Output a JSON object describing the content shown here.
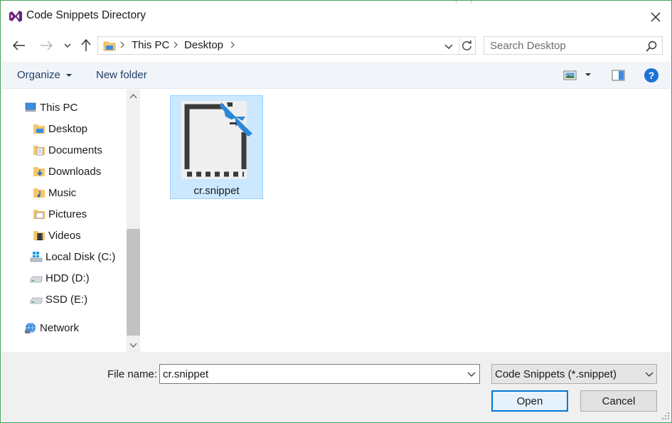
{
  "window": {
    "title": "Code Snippets Directory",
    "app_icon": "visual-studio-icon",
    "accent": "#68217a"
  },
  "nav": {
    "back_icon": "arrow-left-icon",
    "forward_icon": "arrow-right-icon",
    "recent_icon": "chevron-down-icon",
    "up_icon": "arrow-up-icon"
  },
  "address": {
    "crumbs": [
      "This PC",
      "Desktop"
    ],
    "refresh_icon": "refresh-icon"
  },
  "search": {
    "placeholder": "Search Desktop"
  },
  "commands": {
    "organize": "Organize",
    "new_folder": "New folder",
    "view_icon": "change-view-icon",
    "preview_icon": "preview-pane-icon",
    "help_icon": "help-icon"
  },
  "tree": [
    {
      "label": "This PC",
      "icon": "computer-icon"
    },
    {
      "label": "Desktop",
      "icon": "desktop-folder-icon"
    },
    {
      "label": "Documents",
      "icon": "documents-folder-icon"
    },
    {
      "label": "Downloads",
      "icon": "downloads-folder-icon"
    },
    {
      "label": "Music",
      "icon": "music-folder-icon"
    },
    {
      "label": "Pictures",
      "icon": "pictures-folder-icon"
    },
    {
      "label": "Videos",
      "icon": "videos-folder-icon"
    },
    {
      "label": "Local Disk (C:)",
      "icon": "windows-drive-icon"
    },
    {
      "label": "HDD (D:)",
      "icon": "drive-icon"
    },
    {
      "label": "SSD (E:)",
      "icon": "drive-icon"
    },
    {
      "label": "Network",
      "icon": "network-icon"
    }
  ],
  "files": [
    {
      "name": "cr.snippet",
      "icon": "snippet-file-icon",
      "selected": true
    }
  ],
  "footer": {
    "file_name_label": "File name:",
    "file_name_value": "cr.snippet",
    "file_type": "Code Snippets (*.snippet)",
    "open_label": "Open",
    "cancel_label": "Cancel"
  }
}
